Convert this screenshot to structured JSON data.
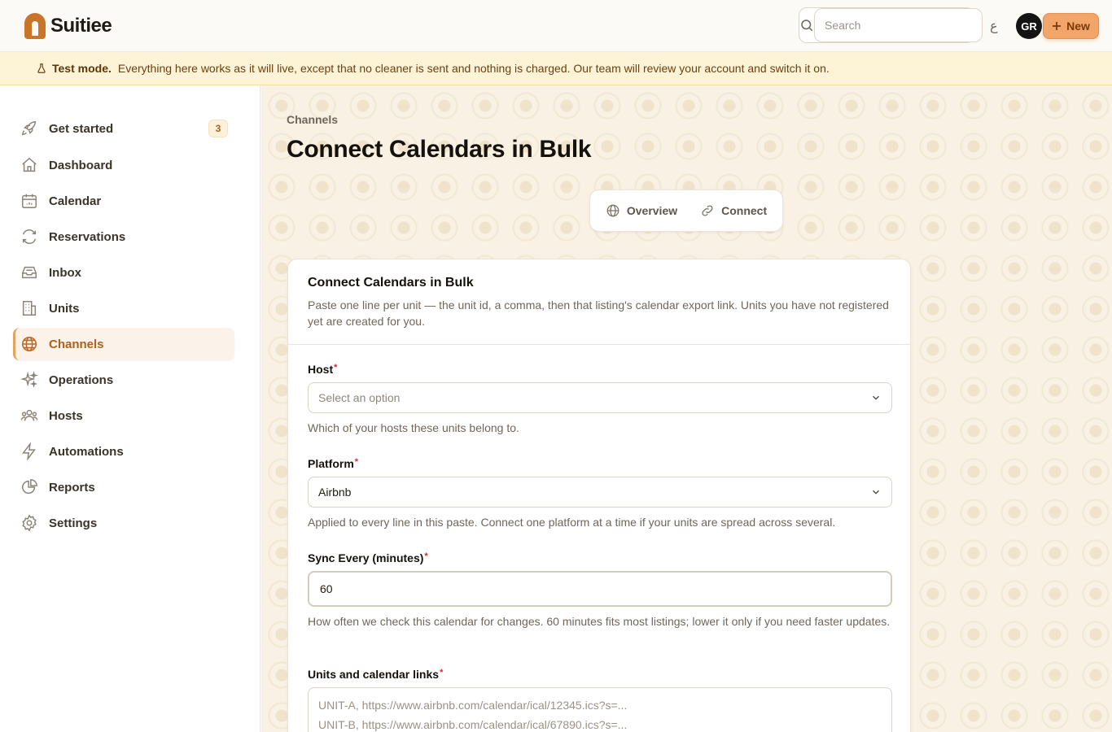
{
  "app": {
    "name": "Suitiee",
    "search_placeholder": "Search",
    "lang_glyph": "ع",
    "user_initials": "GR",
    "new_button": "New"
  },
  "banner": {
    "strong": "Test mode.",
    "text": "Everything here works as it will live, except that no cleaner is sent and nothing is charged. Our team will review your account and switch it on."
  },
  "sidebar": {
    "items": [
      {
        "label": "Get started",
        "icon": "rocket-icon",
        "badge": "3"
      },
      {
        "label": "Dashboard",
        "icon": "home-icon"
      },
      {
        "label": "Calendar",
        "icon": "calendar-icon"
      },
      {
        "label": "Reservations",
        "icon": "refresh-icon"
      },
      {
        "label": "Inbox",
        "icon": "inbox-icon"
      },
      {
        "label": "Units",
        "icon": "building-icon"
      },
      {
        "label": "Channels",
        "icon": "globe-icon",
        "active": true
      },
      {
        "label": "Operations",
        "icon": "sparkles-icon"
      },
      {
        "label": "Hosts",
        "icon": "users-icon"
      },
      {
        "label": "Automations",
        "icon": "bolt-icon"
      },
      {
        "label": "Reports",
        "icon": "pie-chart-icon"
      },
      {
        "label": "Settings",
        "icon": "gear-icon"
      }
    ]
  },
  "page": {
    "breadcrumb": "Channels",
    "title": "Connect Calendars in Bulk",
    "tabs": [
      {
        "label": "Overview",
        "icon": "globe-icon"
      },
      {
        "label": "Connect",
        "icon": "link-icon"
      }
    ]
  },
  "form": {
    "title": "Connect Calendars in Bulk",
    "description": "Paste one line per unit — the unit id, a comma, then that listing's calendar export link. Units you have not registered yet are created for you.",
    "host": {
      "label": "Host",
      "placeholder": "Select an option",
      "helper": "Which of your hosts these units belong to."
    },
    "platform": {
      "label": "Platform",
      "value": "Airbnb",
      "helper": "Applied to every line in this paste. Connect one platform at a time if your units are spread across several."
    },
    "sync": {
      "label": "Sync Every (minutes)",
      "value": "60",
      "helper": "How often we check this calendar for changes. 60 minutes fits most listings; lower it only if you need faster updates."
    },
    "links": {
      "label": "Units and calendar links",
      "placeholder_line1": "UNIT-A, https://www.airbnb.com/calendar/ical/12345.ics?s=...",
      "placeholder_line2": "UNIT-B, https://www.airbnb.com/calendar/ical/67890.ics?s=..."
    },
    "required_mark": "*"
  }
}
